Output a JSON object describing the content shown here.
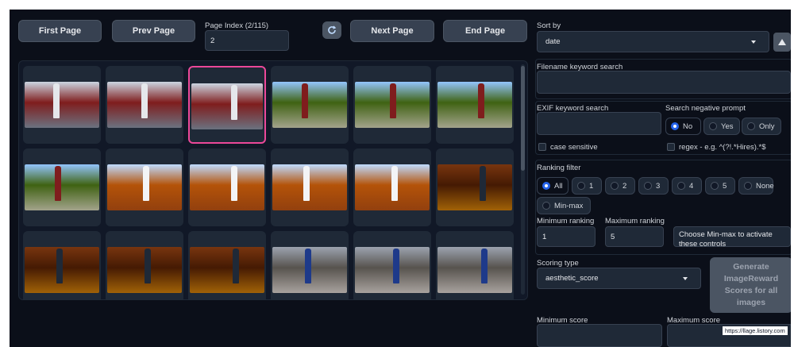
{
  "pagination": {
    "first_label": "First Page",
    "prev_label": "Prev Page",
    "page_index_label": "Page Index (2/115)",
    "page_index_value": "2",
    "refresh_icon": "refresh-icon",
    "next_label": "Next Page",
    "end_label": "End Page"
  },
  "gallery": {
    "thumbnails": [
      {
        "scene": "temple",
        "selected": false
      },
      {
        "scene": "temple",
        "selected": false
      },
      {
        "scene": "temple",
        "selected": true
      },
      {
        "scene": "path",
        "selected": false
      },
      {
        "scene": "path",
        "selected": false
      },
      {
        "scene": "path",
        "selected": false
      },
      {
        "scene": "path",
        "selected": false
      },
      {
        "scene": "canyon",
        "selected": false
      },
      {
        "scene": "canyon",
        "selected": false
      },
      {
        "scene": "canyon",
        "selected": false
      },
      {
        "scene": "canyon",
        "selected": false
      },
      {
        "scene": "arch",
        "selected": false
      },
      {
        "scene": "arch",
        "selected": false
      },
      {
        "scene": "arch",
        "selected": false
      },
      {
        "scene": "arch",
        "selected": false
      },
      {
        "scene": "ruins",
        "selected": false
      },
      {
        "scene": "ruins",
        "selected": false
      },
      {
        "scene": "ruins",
        "selected": false
      }
    ]
  },
  "sidebar": {
    "sort_by_label": "Sort by",
    "sort_by_value": "date",
    "sort_direction_icon": "triangle-up-icon",
    "filename_search_label": "Filename keyword search",
    "filename_search_value": "",
    "exif_search_label": "EXIF keyword search",
    "exif_search_value": "",
    "negative_prompt_label": "Search negative prompt",
    "negative_prompt_options": [
      "No",
      "Yes",
      "Only"
    ],
    "negative_prompt_selected": "No",
    "case_sensitive_label": "case sensitive",
    "regex_label": "regex - e.g. ^(?!.*Hires).*$",
    "ranking_filter_label": "Ranking filter",
    "ranking_options": [
      "All",
      "1",
      "2",
      "3",
      "4",
      "5",
      "None",
      "Min-max"
    ],
    "ranking_selected": "All",
    "min_ranking_label": "Minimum ranking",
    "min_ranking_value": "1",
    "max_ranking_label": "Maximum ranking",
    "max_ranking_value": "5",
    "minmax_hint": "Choose Min-max to activate these controls",
    "scoring_type_label": "Scoring type",
    "scoring_type_value": "aesthetic_score",
    "generate_label": "Generate ImageReward Scores for all images",
    "min_score_label": "Minimum score",
    "max_score_label": "Maximum score",
    "watermark": "https://llage.listory.com"
  },
  "colors": {
    "background": "#0b0f19",
    "panel": "#1f2937",
    "button": "#374151",
    "selected_border": "#ec4899",
    "radio_accent": "#2563eb"
  }
}
